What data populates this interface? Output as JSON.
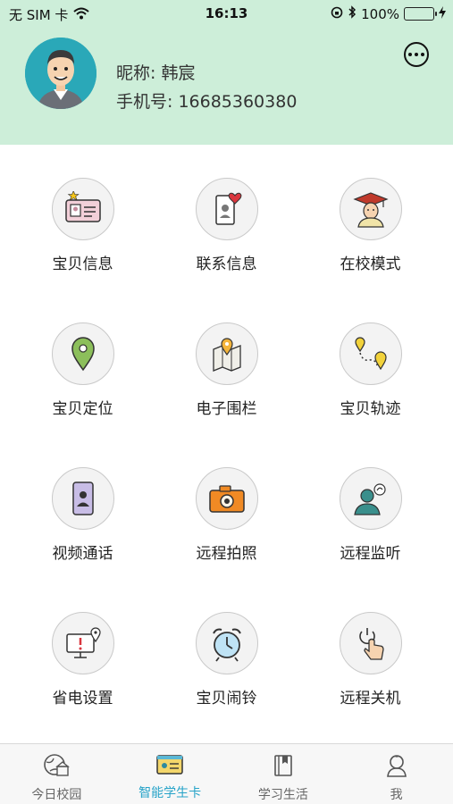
{
  "status_bar": {
    "carrier": "无 SIM 卡",
    "time": "16:13",
    "battery_percent": "100%",
    "icons": [
      "wifi-icon",
      "rotation-lock-icon",
      "bluetooth-icon",
      "battery-icon",
      "charging-icon"
    ]
  },
  "profile": {
    "nickname": "昵称: 韩宸",
    "phone": "手机号: 16685360380",
    "avatar_icon": "user-avatar"
  },
  "grid": {
    "items": [
      {
        "label": "宝贝信息",
        "icon": "id-card-icon"
      },
      {
        "label": "联系信息",
        "icon": "phone-heart-icon"
      },
      {
        "label": "在校模式",
        "icon": "graduate-icon"
      },
      {
        "label": "宝贝定位",
        "icon": "location-pin-icon"
      },
      {
        "label": "电子围栏",
        "icon": "map-fence-icon"
      },
      {
        "label": "宝贝轨迹",
        "icon": "route-icon"
      },
      {
        "label": "视频通话",
        "icon": "video-call-icon"
      },
      {
        "label": "远程拍照",
        "icon": "camera-icon"
      },
      {
        "label": "远程监听",
        "icon": "listen-icon"
      },
      {
        "label": "省电设置",
        "icon": "monitor-alert-icon"
      },
      {
        "label": "宝贝闹铃",
        "icon": "alarm-clock-icon"
      },
      {
        "label": "远程关机",
        "icon": "power-touch-icon"
      }
    ]
  },
  "tabbar": {
    "tabs": [
      {
        "label": "今日校园",
        "icon": "campus-globe-icon"
      },
      {
        "label": "智能学生卡",
        "icon": "student-card-icon",
        "active": true
      },
      {
        "label": "学习生活",
        "icon": "book-icon"
      },
      {
        "label": "我",
        "icon": "profile-icon"
      }
    ]
  },
  "colors": {
    "header_bg": "#cdeed9",
    "active_tab": "#27a3c8"
  }
}
